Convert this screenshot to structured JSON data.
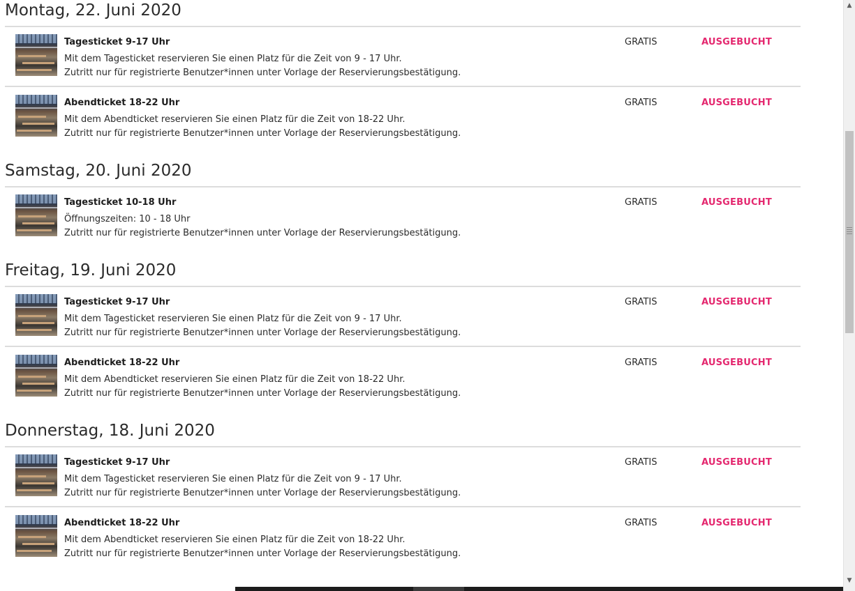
{
  "colors": {
    "accent": "#e4286f",
    "divider": "#dcdcdc",
    "text": "#2b2b2b"
  },
  "days": [
    {
      "title": "Montag, 22. Juni 2020",
      "tickets": [
        {
          "name": "Tagesticket 9-17 Uhr",
          "line1": "Mit dem Tagesticket reservieren Sie einen Platz für die Zeit von 9 - 17 Uhr.",
          "line2": "Zutritt nur für registrierte Benutzer*innen unter Vorlage der Reservierungsbestätigung.",
          "price": "GRATIS",
          "status": "AUSGEBUCHT"
        },
        {
          "name": "Abendticket 18-22 Uhr",
          "line1": "Mit dem Abendticket reservieren Sie einen Platz für die Zeit von 18-22 Uhr.",
          "line2": "Zutritt nur für registrierte Benutzer*innen unter Vorlage der Reservierungsbestätigung.",
          "price": "GRATIS",
          "status": "AUSGEBUCHT"
        }
      ]
    },
    {
      "title": "Samstag, 20. Juni 2020",
      "tickets": [
        {
          "name": "Tagesticket 10-18 Uhr",
          "line1": "Öffnungszeiten: 10 - 18 Uhr",
          "line2": "Zutritt nur für registrierte Benutzer*innen unter Vorlage der Reservierungsbestätigung.",
          "price": "GRATIS",
          "status": "AUSGEBUCHT"
        }
      ]
    },
    {
      "title": "Freitag, 19. Juni 2020",
      "tickets": [
        {
          "name": "Tagesticket 9-17 Uhr",
          "line1": "Mit dem Tagesticket reservieren Sie einen Platz für die Zeit von 9 - 17 Uhr.",
          "line2": "Zutritt nur für registrierte Benutzer*innen unter Vorlage der Reservierungsbestätigung.",
          "price": "GRATIS",
          "status": "AUSGEBUCHT"
        },
        {
          "name": "Abendticket 18-22 Uhr",
          "line1": "Mit dem Abendticket reservieren Sie einen Platz für die Zeit von 18-22 Uhr.",
          "line2": "Zutritt nur für registrierte Benutzer*innen unter Vorlage der Reservierungsbestätigung.",
          "price": "GRATIS",
          "status": "AUSGEBUCHT"
        }
      ]
    },
    {
      "title": "Donnerstag, 18. Juni 2020",
      "tickets": [
        {
          "name": "Tagesticket 9-17 Uhr",
          "line1": "Mit dem Tagesticket reservieren Sie einen Platz für die Zeit von 9 - 17 Uhr.",
          "line2": "Zutritt nur für registrierte Benutzer*innen unter Vorlage der Reservierungsbestätigung.",
          "price": "GRATIS",
          "status": "AUSGEBUCHT"
        },
        {
          "name": "Abendticket 18-22 Uhr",
          "line1": "Mit dem Abendticket reservieren Sie einen Platz für die Zeit von 18-22 Uhr.",
          "line2": "Zutritt nur für registrierte Benutzer*innen unter Vorlage der Reservierungsbestätigung.",
          "price": "GRATIS",
          "status": "AUSGEBUCHT"
        }
      ]
    }
  ],
  "scrollbar": {
    "up_icon": "triangle-up",
    "down_icon": "triangle-down"
  }
}
